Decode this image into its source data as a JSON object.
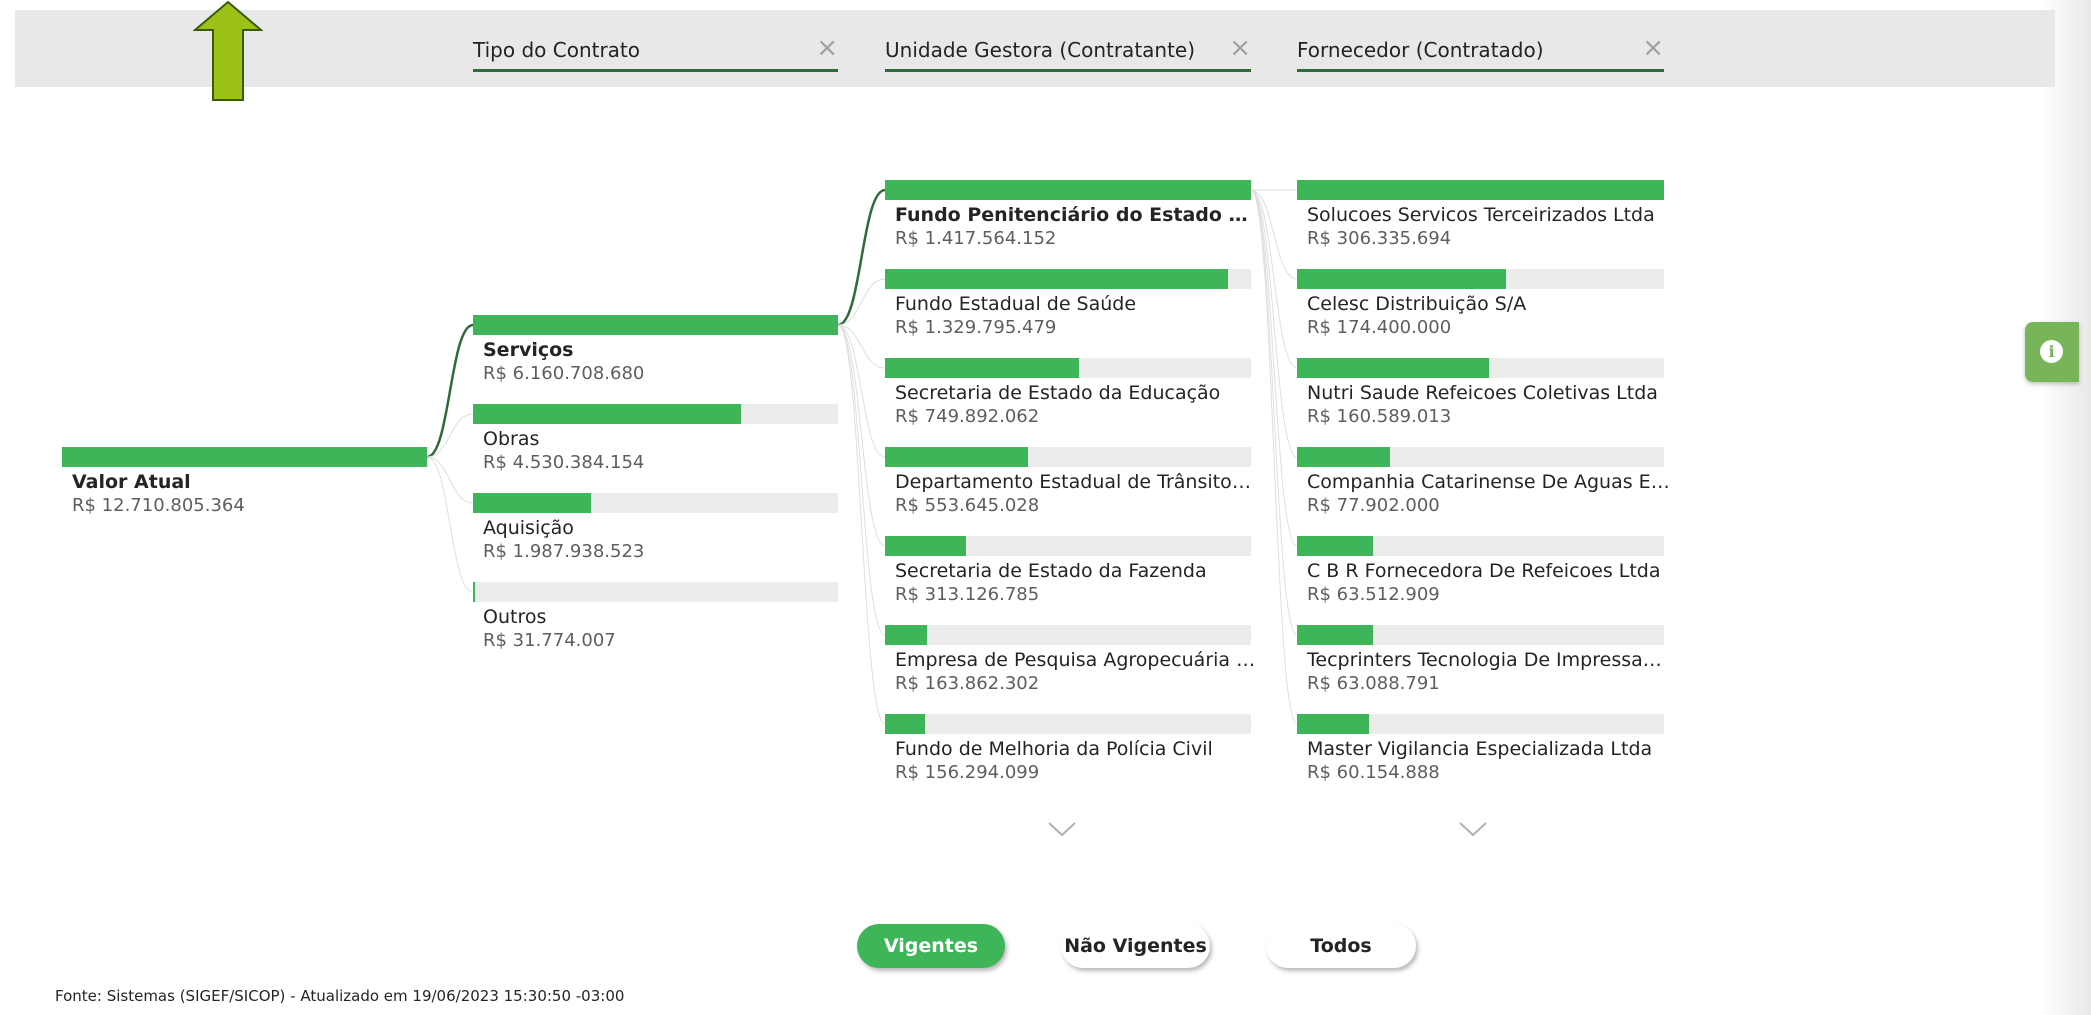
{
  "colors": {
    "bar_fill": "#3fb559",
    "bar_track": "#ececec",
    "header_bg": "#e8e8e8",
    "active_link": "#2f6b3a",
    "arrow_fill": "#9cc21a"
  },
  "header": {
    "filters": [
      {
        "label": "Tipo do Contrato",
        "close_icon": "×"
      },
      {
        "label": "Unidade Gestora (Contratante)",
        "close_icon": "×"
      },
      {
        "label": "Fornecedor (Contratado)",
        "close_icon": "×"
      }
    ]
  },
  "root": {
    "label": "Valor Atual",
    "value": "R$ 12.710.805.364",
    "fraction": 1.0
  },
  "tipo": [
    {
      "label": "Serviços",
      "value": "R$ 6.160.708.680",
      "fraction": 1.0,
      "selected": true
    },
    {
      "label": "Obras",
      "value": "R$ 4.530.384.154",
      "fraction": 0.735
    },
    {
      "label": "Aquisição",
      "value": "R$ 1.987.938.523",
      "fraction": 0.323
    },
    {
      "label": "Outros",
      "value": "R$ 31.774.007",
      "fraction": 0.005
    }
  ],
  "unidade": [
    {
      "label": "Fundo Penitenciário do Estado de Sa...",
      "value": "R$ 1.417.564.152",
      "fraction": 1.0,
      "selected": true
    },
    {
      "label": "Fundo Estadual de Saúde",
      "value": "R$ 1.329.795.479",
      "fraction": 0.938
    },
    {
      "label": "Secretaria de Estado da Educação",
      "value": "R$ 749.892.062",
      "fraction": 0.529
    },
    {
      "label": "Departamento Estadual de Trânsito- DE...",
      "value": "R$ 553.645.028",
      "fraction": 0.391
    },
    {
      "label": "Secretaria de Estado da Fazenda",
      "value": "R$ 313.126.785",
      "fraction": 0.221
    },
    {
      "label": "Empresa de Pesquisa Agropecuária e Ex...",
      "value": "R$ 163.862.302",
      "fraction": 0.116
    },
    {
      "label": "Fundo de Melhoria da Polícia Civil",
      "value": "R$ 156.294.099",
      "fraction": 0.11
    }
  ],
  "fornecedor": [
    {
      "label": "Solucoes Servicos Terceirizados Ltda",
      "value": "R$ 306.335.694",
      "fraction": 1.0
    },
    {
      "label": "Celesc Distribuição S/A",
      "value": "R$ 174.400.000",
      "fraction": 0.569
    },
    {
      "label": "Nutri Saude Refeicoes Coletivas Ltda",
      "value": "R$ 160.589.013",
      "fraction": 0.524
    },
    {
      "label": "Companhia Catarinense De Aguas E Sa...",
      "value": "R$ 77.902.000",
      "fraction": 0.254
    },
    {
      "label": "C B R Fornecedora De Refeicoes Ltda",
      "value": "R$ 63.512.909",
      "fraction": 0.207
    },
    {
      "label": "Tecprinters Tecnologia De Impressao Ltda",
      "value": "R$ 63.088.791",
      "fraction": 0.206
    },
    {
      "label": "Master Vigilancia Especializada Ltda",
      "value": "R$ 60.154.888",
      "fraction": 0.196
    }
  ],
  "buttons": {
    "vigentes": "Vigentes",
    "nao_vigentes": "Não Vigentes",
    "todos": "Todos"
  },
  "info_icon": "i",
  "footer": "Fonte: Sistemas (SIGEF/SICOP) - Atualizado em 19/06/2023 15:30:50 -03:00"
}
